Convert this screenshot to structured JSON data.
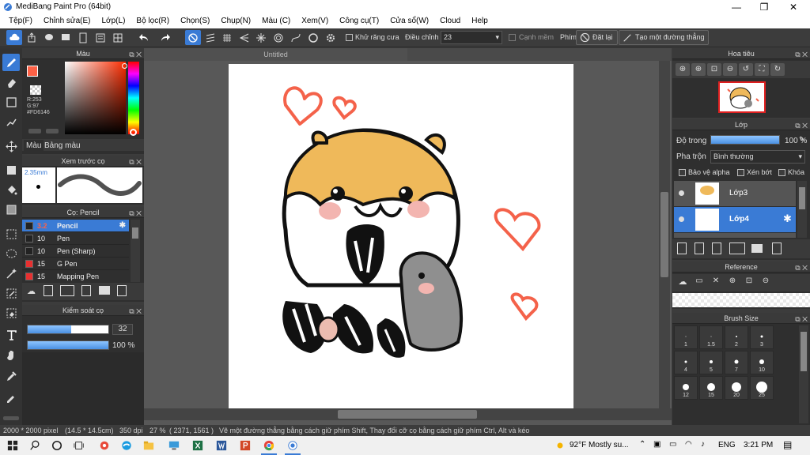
{
  "window": {
    "title": "MediBang Paint Pro (64bit)",
    "minimize": "—",
    "restore": "❐",
    "close": "✕"
  },
  "menu": [
    "Tệp(F)",
    "Chỉnh sửa(E)",
    "Lớp(L)",
    "Bộ lọc(R)",
    "Chọn(S)",
    "Chụp(N)",
    "Màu (C)",
    "Xem(V)",
    "Công cụ(T)",
    "Cửa sổ(W)",
    "Cloud",
    "Help"
  ],
  "toolbar": {
    "antialias_label": "Khử răng cưa",
    "adjust_label": "Điều chỉnh",
    "adjust_value": "23",
    "soft_edge_label": "Cạnh mềm",
    "key_label": "Phím",
    "reset_label": "Đặt lại",
    "straight_line_label": "Tạo một đường thẳng"
  },
  "color_panel": {
    "title": "Màu",
    "r": "R:253",
    "g": "G:97",
    "hex": "#FD6146",
    "tab_color": "Màu",
    "tab_palette": "Bảng màu",
    "accent": "#fd6146"
  },
  "brush_preview": {
    "title": "Xem trước cọ",
    "size": "2.35mm"
  },
  "brush_panel": {
    "title": "Cọ: Pencil",
    "items": [
      {
        "size": "3.2",
        "name": "Pencil",
        "color": "#222222",
        "selected": true
      },
      {
        "size": "10",
        "name": "Pen",
        "color": "#222222",
        "selected": false
      },
      {
        "size": "10",
        "name": "Pen (Sharp)",
        "color": "#222222",
        "selected": false
      },
      {
        "size": "15",
        "name": "G Pen",
        "color": "#e83030",
        "selected": false
      },
      {
        "size": "15",
        "name": "Mapping Pen",
        "color": "#e83030",
        "selected": false
      }
    ]
  },
  "brush_control": {
    "title": "Kiểm soát cọ",
    "size_value": "32",
    "opacity_value": "100 %",
    "size_fraction": 0.32,
    "opacity_fraction": 1.0
  },
  "canvas": {
    "tab": "Untitled"
  },
  "navigator": {
    "title": "Hoa tiêu"
  },
  "layers": {
    "title": "Lớp",
    "opacity_label": "Độ trong",
    "opacity_value": "100 %",
    "blend_label": "Pha trộn",
    "blend_value": "Bình thường",
    "protect_alpha": "Bảo vệ alpha",
    "clipping": "Xén bớt",
    "lock": "Khóa",
    "items": [
      {
        "name": "Lớp3",
        "selected": false
      },
      {
        "name": "Lớp4",
        "selected": true
      }
    ]
  },
  "reference": {
    "title": "Reference"
  },
  "brush_size": {
    "title": "Brush Size",
    "sizes": [
      "1",
      "1.5",
      "2",
      "3",
      "4",
      "5",
      "7",
      "10",
      "12",
      "15",
      "20",
      "25"
    ]
  },
  "status": {
    "dimensions": "2000 * 2000 pixel",
    "physical": "(14.5 * 14.5cm)",
    "dpi": "350 dpi",
    "zoom": "27 %",
    "coords": "( 2371, 1561 )",
    "hint": "Vẽ một đường thẳng bằng cách giữ phím Shift, Thay đổi cỡ cọ bằng cách giữ phím Ctrl, Alt và kéo"
  },
  "taskbar": {
    "weather": "92°F  Mostly su...",
    "lang": "ENG",
    "time": "3:21 PM"
  }
}
